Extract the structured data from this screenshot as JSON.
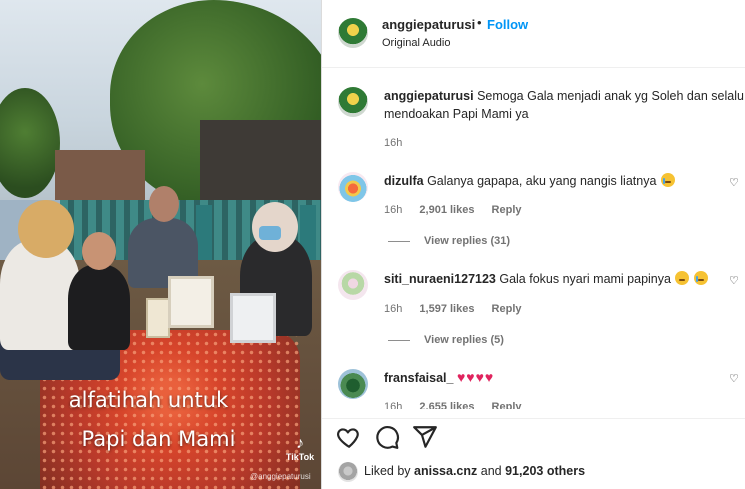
{
  "post": {
    "author": "anggiepaturusi",
    "dot": "•",
    "follow_label": "Follow",
    "audio": "Original Audio"
  },
  "media": {
    "caption_line1": "alfatihah untuk",
    "caption_line2": "Papi dan Mami",
    "tiktok_label": "TikTok",
    "tiktok_handle": "@anggiepaturusi"
  },
  "caption_comment": {
    "user": "anggiepaturusi",
    "text_line1": "Semoga Gala menjadi anak yg Soleh dan selalu",
    "text_line2": "mendoakan Papi Mami ya",
    "time": "16h"
  },
  "comments": [
    {
      "user": "dizulfa",
      "text": "Galanya gapapa, aku yang nangis liatnya",
      "emoji": "crying-face",
      "time": "16h",
      "likes": "2,901 likes",
      "reply": "Reply",
      "view_replies": "View replies (31)"
    },
    {
      "user": "siti_nuraeni127123",
      "text": "Gala fokus nyari mami papinya",
      "emoji": "sad-face crying-face",
      "time": "16h",
      "likes": "1,597 likes",
      "reply": "Reply",
      "view_replies": "View replies (5)"
    },
    {
      "user": "fransfaisal_",
      "text": "♥♥♥♥",
      "time": "16h",
      "likes": "2,655 likes",
      "reply": "Reply"
    }
  ],
  "likes_summary": {
    "prefix": "Liked by",
    "user": "anissa.cnz",
    "conj": "and",
    "count": "91,203 others"
  },
  "colors": {
    "follow_blue": "#0095f6",
    "heart_red": "#e0245e",
    "meta_gray": "#737373"
  },
  "icons": [
    "heart-outline-icon",
    "comment-icon",
    "share-icon",
    "tiktok-icon",
    "small-heart-icon"
  ]
}
